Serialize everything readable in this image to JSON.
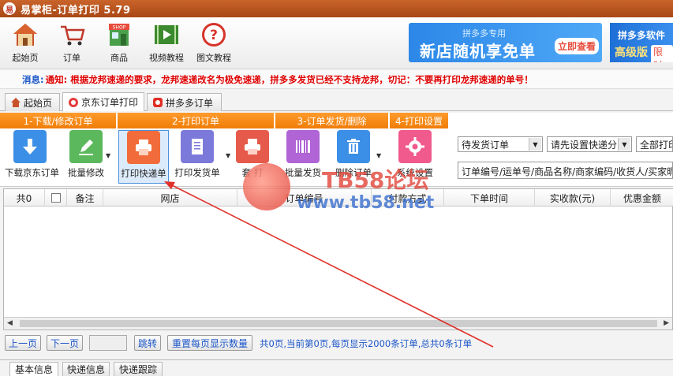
{
  "window": {
    "title": "易掌柜-订单打印 5.79",
    "logo_char": "易"
  },
  "main_toolbar": [
    {
      "label": "起始页",
      "icon": "home-icon"
    },
    {
      "label": "订单",
      "icon": "cart-icon"
    },
    {
      "label": "商品",
      "icon": "shop-icon"
    },
    {
      "label": "视频教程",
      "icon": "video-icon"
    },
    {
      "label": "图文教程",
      "icon": "help-icon"
    }
  ],
  "banners": {
    "pdd_promo": {
      "sub": "拼多多专用",
      "big": "新店随机享免单",
      "button": "立即查看"
    },
    "pdd_software": {
      "line1": "拼多多软件",
      "line2": "高级版",
      "tag": "限时"
    }
  },
  "notice": {
    "label": "消息:",
    "text": "通知: 根据龙邦速递的要求，龙邦速递改名为极免速递，拼多多发货已经不支持龙邦，切记：不要再打印龙邦速递的单号！"
  },
  "tabs": [
    {
      "label": "起始页",
      "icon": "home-icon"
    },
    {
      "label": "京东订单打印",
      "icon": "jd-icon"
    },
    {
      "label": "拼多多订单",
      "icon": "pdd-icon"
    }
  ],
  "groups": [
    "1-下载/修改订单",
    "2-打印订单",
    "3-订单发货/删除",
    "4-打印设置"
  ],
  "order_toolbar": [
    {
      "label": "下载京东订单",
      "icon": "download-icon",
      "color": "#3b8fe6"
    },
    {
      "label": "批量修改",
      "icon": "edit-icon",
      "color": "#5cb85c"
    },
    {
      "label": "打印快递单",
      "icon": "printer-icon",
      "color": "#f26b3a"
    },
    {
      "label": "打印发货单",
      "icon": "receipt-icon",
      "color": "#7b79d9"
    },
    {
      "label": "套 打",
      "icon": "print-form-icon",
      "color": "#e55a4a"
    },
    {
      "label": "批量发货",
      "icon": "barcode-icon",
      "color": "#b064d6"
    },
    {
      "label": "删除订单",
      "icon": "trash-icon",
      "color": "#3b8fe6"
    },
    {
      "label": "系统设置",
      "icon": "gear-icon",
      "color": "#f05a8c"
    }
  ],
  "filters": {
    "status": "待发货订单",
    "express": "请先设置快递分",
    "scope": "全部打印",
    "search_placeholder": "订单编号/运单号/商品名称/商家编码/收货人/买家昵称"
  },
  "grid_columns": [
    "共0",
    "",
    "备注",
    "网店",
    "订单编号",
    "付款方式",
    "下单时间",
    "实收款(元)",
    "优惠金额"
  ],
  "pager": {
    "prev": "上一页",
    "next": "下一页",
    "jump": "跳转",
    "reset": "重置每页显示数量",
    "info": "共0页,当前第0页,每页显示2000条订单,总共0条订单"
  },
  "bottom_tabs": [
    "基本信息",
    "快递信息",
    "快递跟踪"
  ],
  "watermark": {
    "title": "TB58论坛",
    "url": "www.tb58.net"
  }
}
